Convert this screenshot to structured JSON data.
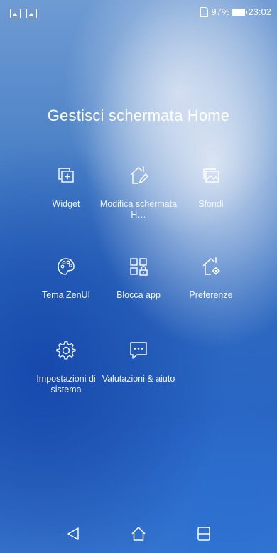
{
  "status_bar": {
    "battery_percent": "97%",
    "time": "23:02",
    "notification_icons": [
      "image-icon",
      "image-icon"
    ]
  },
  "page": {
    "title": "Gestisci schermata Home"
  },
  "menu": [
    {
      "label": "Widget",
      "icon": "widget-add-icon"
    },
    {
      "label": "Modifica schermata H…",
      "icon": "edit-home-icon"
    },
    {
      "label": "Sfondi",
      "icon": "wallpaper-icon"
    },
    {
      "label": "Tema ZenUI",
      "icon": "palette-icon"
    },
    {
      "label": "Blocca app",
      "icon": "lock-apps-icon"
    },
    {
      "label": "Preferenze",
      "icon": "home-settings-icon"
    },
    {
      "label": "Impostazioni di sistema",
      "icon": "gear-icon"
    },
    {
      "label": "Valutazioni & aiuto",
      "icon": "feedback-icon"
    }
  ],
  "nav_bar": {
    "buttons": [
      "back-icon",
      "home-icon",
      "recents-icon"
    ]
  }
}
